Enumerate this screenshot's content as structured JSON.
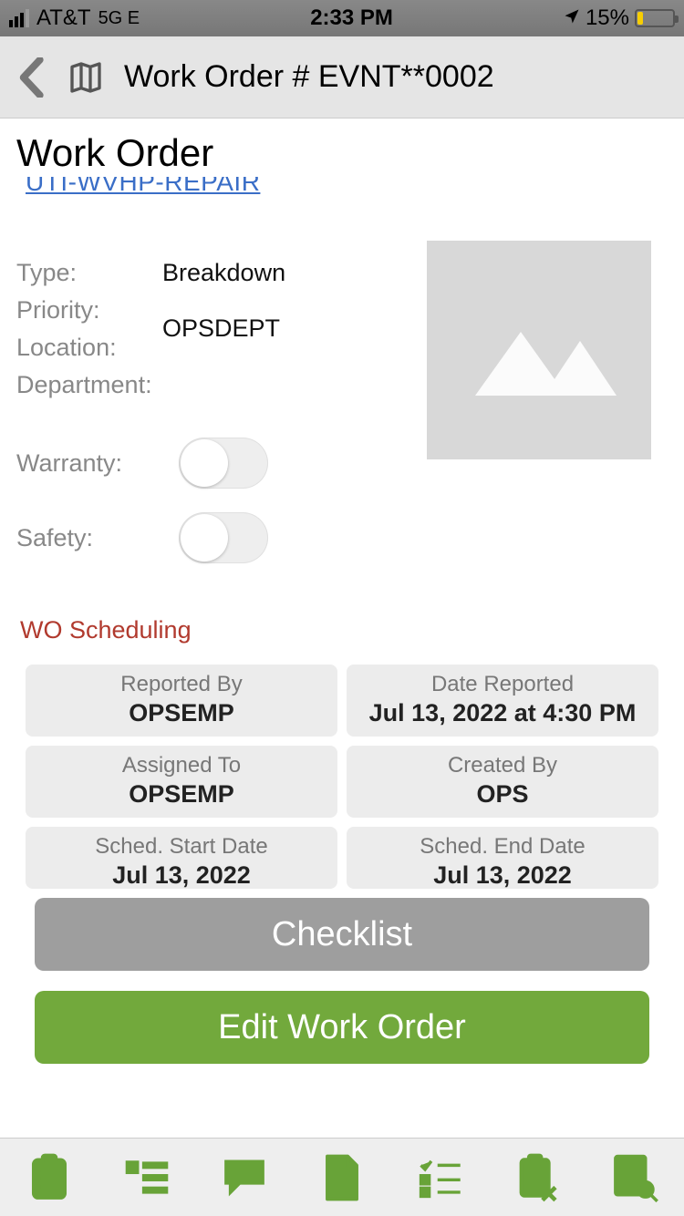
{
  "status": {
    "carrier": "AT&T",
    "net": "5G E",
    "time": "2:33 PM",
    "battery": "15%"
  },
  "nav": {
    "title": "Work Order # EVNT**0002"
  },
  "heading": "Work Order",
  "link": "UTI-WVHP-REPAIR",
  "details": {
    "labels": {
      "type": "Type:",
      "priority": "Priority:",
      "location": "Location:",
      "department": "Department:",
      "warranty": "Warranty:",
      "safety": "Safety:"
    },
    "values": {
      "type": "Breakdown",
      "priority": "",
      "location": "",
      "department": "OPSDEPT"
    }
  },
  "section": "WO Scheduling",
  "cards": {
    "reportedBy": {
      "label": "Reported By",
      "value": "OPSEMP"
    },
    "dateReported": {
      "label": "Date Reported",
      "value": "Jul 13, 2022 at 4:30 PM"
    },
    "assignedTo": {
      "label": "Assigned To",
      "value": "OPSEMP"
    },
    "createdBy": {
      "label": "Created By",
      "value": "OPS"
    },
    "schedStart": {
      "label": "Sched. Start Date",
      "value": "Jul 13, 2022"
    },
    "schedEnd": {
      "label": "Sched. End Date",
      "value": "Jul 13, 2022"
    }
  },
  "buttons": {
    "checklist": "Checklist",
    "edit": "Edit Work Order"
  }
}
